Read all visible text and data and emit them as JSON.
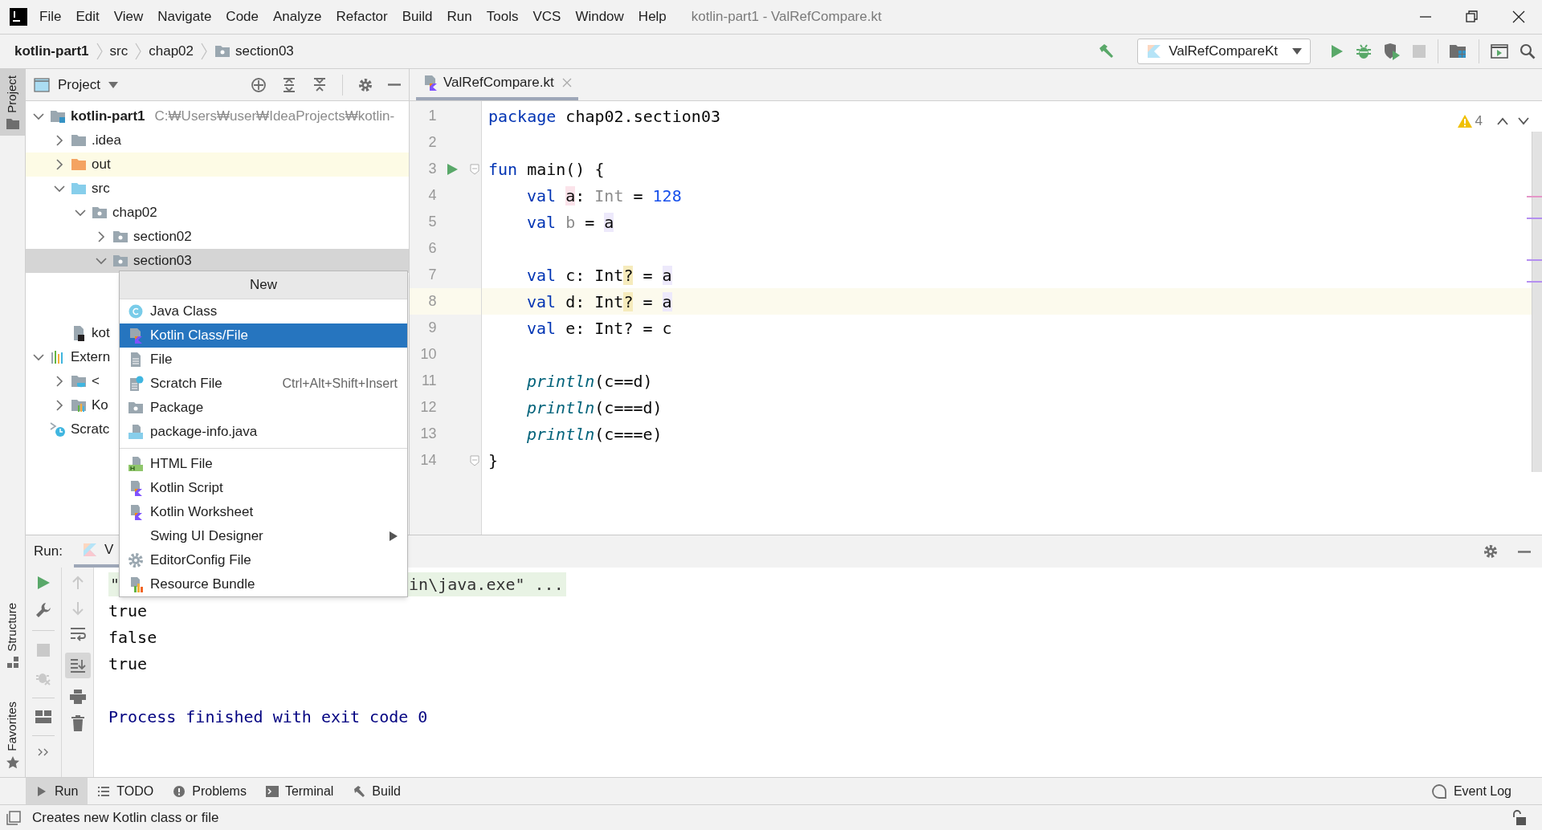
{
  "window": {
    "title": "kotlin-part1 - ValRefCompare.kt"
  },
  "menu_bar": [
    "File",
    "Edit",
    "View",
    "Navigate",
    "Code",
    "Analyze",
    "Refactor",
    "Build",
    "Run",
    "Tools",
    "VCS",
    "Window",
    "Help"
  ],
  "breadcrumbs": [
    {
      "label": "kotlin-part1",
      "kind": "project"
    },
    {
      "label": "src",
      "kind": "plain"
    },
    {
      "label": "chap02",
      "kind": "plain"
    },
    {
      "label": "section03",
      "kind": "package"
    }
  ],
  "run_configuration": "ValRefCompareKt",
  "side_tabs": [
    {
      "label": "Project",
      "selected": true,
      "kind": "top"
    },
    {
      "label": "Structure",
      "selected": false,
      "kind": "bottom"
    },
    {
      "label": "Favorites",
      "selected": false,
      "kind": "bottom"
    }
  ],
  "project_panel": {
    "title": "Project",
    "tree": [
      {
        "label": "kotlin-part1",
        "path": "C:₩Users₩user₩IdeaProjects₩kotlin-",
        "kind": "module",
        "expanded": true,
        "selected": false,
        "children": [
          {
            "label": ".idea",
            "kind": "folder",
            "expanded": false,
            "selected": false
          },
          {
            "label": "out",
            "kind": "excluded-folder",
            "expanded": false,
            "selected": false
          },
          {
            "label": "src",
            "kind": "source-folder",
            "expanded": true,
            "selected": false,
            "children": [
              {
                "label": "chap02",
                "kind": "package",
                "expanded": true,
                "selected": false,
                "children": [
                  {
                    "label": "section02",
                    "kind": "package",
                    "expanded": false,
                    "selected": false
                  },
                  {
                    "label": "section03",
                    "kind": "package",
                    "expanded": true,
                    "selected": true
                  }
                ]
              }
            ]
          },
          {
            "label": "kot",
            "kind": "module-file",
            "selected": false
          }
        ]
      },
      {
        "label": "Extern",
        "kind": "libraries",
        "expanded": true,
        "selected": false,
        "children": [
          {
            "label": "<",
            "kind": "sdk",
            "expanded": false,
            "selected": false
          },
          {
            "label": "Ko",
            "kind": "library",
            "expanded": false,
            "selected": false
          }
        ]
      },
      {
        "label": "Scratc",
        "kind": "scratches",
        "selected": false
      }
    ]
  },
  "editor": {
    "tabs": [
      {
        "label": "ValRefCompare.kt",
        "selected": true
      }
    ],
    "warnings": "4",
    "lines": [
      {
        "number": "1",
        "current": false,
        "runnable": false,
        "fold": false,
        "indented": false,
        "tokens": [
          {
            "text": "package",
            "kind": "keyword"
          },
          {
            "text": " chap02.section03",
            "kind": "plain"
          }
        ]
      },
      {
        "number": "2",
        "current": false,
        "runnable": false,
        "fold": false
      },
      {
        "number": "3",
        "current": false,
        "runnable": true,
        "fold": true,
        "indented": false,
        "tokens": [
          {
            "text": "fun",
            "kind": "keyword"
          },
          {
            "text": " main() {",
            "kind": "plain"
          }
        ]
      },
      {
        "number": "4",
        "current": false,
        "runnable": false,
        "fold": false,
        "indented": true,
        "tokens": [
          {
            "text": "val ",
            "kind": "keyword"
          },
          {
            "text": "a",
            "kind": "plain",
            "write_access": true
          },
          {
            "text": ": ",
            "kind": "plain"
          },
          {
            "text": "Int",
            "kind": "unused"
          },
          {
            "text": " = ",
            "kind": "plain"
          },
          {
            "text": "128",
            "kind": "number"
          }
        ]
      },
      {
        "number": "5",
        "current": false,
        "runnable": false,
        "fold": false,
        "indented": true,
        "tokens": [
          {
            "text": "val ",
            "kind": "keyword"
          },
          {
            "text": "b",
            "kind": "unused"
          },
          {
            "text": " = ",
            "kind": "plain"
          },
          {
            "text": "a",
            "kind": "plain",
            "read_access": true
          }
        ]
      },
      {
        "number": "6",
        "current": false,
        "runnable": false,
        "fold": false
      },
      {
        "number": "7",
        "current": false,
        "runnable": false,
        "fold": false,
        "indented": true,
        "tokens": [
          {
            "text": "val",
            "kind": "keyword"
          },
          {
            "text": " c: Int",
            "kind": "plain"
          },
          {
            "text": "?",
            "kind": "plain",
            "warning": true
          },
          {
            "text": " = ",
            "kind": "plain"
          },
          {
            "text": "a",
            "kind": "plain",
            "read_access": true
          }
        ]
      },
      {
        "number": "8",
        "current": true,
        "runnable": false,
        "fold": false,
        "indented": true,
        "tokens": [
          {
            "text": "val",
            "kind": "keyword"
          },
          {
            "text": " d: Int",
            "kind": "plain"
          },
          {
            "text": "?",
            "kind": "plain",
            "warning": true
          },
          {
            "text": " = ",
            "kind": "plain"
          },
          {
            "text": "a",
            "kind": "plain",
            "read_access": true
          }
        ]
      },
      {
        "number": "9",
        "current": false,
        "runnable": false,
        "fold": false,
        "indented": true,
        "tokens": [
          {
            "text": "val",
            "kind": "keyword"
          },
          {
            "text": " e: Int? = c",
            "kind": "plain"
          }
        ]
      },
      {
        "number": "10",
        "current": false,
        "runnable": false,
        "fold": false
      },
      {
        "number": "11",
        "current": false,
        "runnable": false,
        "fold": false,
        "indented": true,
        "tokens": [
          {
            "text": "println",
            "kind": "call"
          },
          {
            "text": "(c==d)",
            "kind": "plain"
          }
        ]
      },
      {
        "number": "12",
        "current": false,
        "runnable": false,
        "fold": false,
        "indented": true,
        "tokens": [
          {
            "text": "println",
            "kind": "call"
          },
          {
            "text": "(c===d)",
            "kind": "plain"
          }
        ]
      },
      {
        "number": "13",
        "current": false,
        "runnable": false,
        "fold": false,
        "indented": true,
        "tokens": [
          {
            "text": "println",
            "kind": "call"
          },
          {
            "text": "(c===e)",
            "kind": "plain"
          }
        ]
      },
      {
        "number": "14",
        "current": false,
        "runnable": false,
        "fold": true,
        "indented": false,
        "tokens": [
          {
            "text": "}",
            "kind": "plain"
          }
        ]
      }
    ]
  },
  "context_menu": {
    "title": "New",
    "items": [
      {
        "label": "Java Class",
        "kind": "java-class",
        "selected": false,
        "separator_before": false,
        "submenu": false
      },
      {
        "label": "Kotlin Class/File",
        "kind": "kotlin-file",
        "selected": true,
        "separator_before": false,
        "submenu": false
      },
      {
        "label": "File",
        "kind": "file",
        "selected": false,
        "separator_before": false,
        "submenu": false
      },
      {
        "label": "Scratch File",
        "kind": "scratch",
        "selected": false,
        "separator_before": false,
        "submenu": false,
        "shortcut": "Ctrl+Alt+Shift+Insert"
      },
      {
        "label": "Package",
        "kind": "package",
        "selected": false,
        "separator_before": false,
        "submenu": false
      },
      {
        "label": "package-info.java",
        "kind": "java-file",
        "selected": false,
        "separator_before": false,
        "submenu": false
      },
      {
        "label": "HTML File",
        "kind": "html",
        "selected": false,
        "separator_before": true,
        "submenu": false
      },
      {
        "label": "Kotlin Script",
        "kind": "kotlin-script",
        "selected": false,
        "separator_before": false,
        "submenu": false
      },
      {
        "label": "Kotlin Worksheet",
        "kind": "kotlin-script",
        "selected": false,
        "separator_before": false,
        "submenu": false
      },
      {
        "label": "Swing UI Designer",
        "kind": "none",
        "selected": false,
        "separator_before": false,
        "submenu": true
      },
      {
        "label": "EditorConfig File",
        "kind": "gear",
        "selected": false,
        "separator_before": false,
        "submenu": false
      },
      {
        "label": "Resource Bundle",
        "kind": "bundle",
        "selected": false,
        "separator_before": false,
        "submenu": false
      }
    ]
  },
  "run_panel": {
    "label": "Run:",
    "tab": "V",
    "scroll_to_end": true,
    "console": [
      {
        "kind": "command",
        "parts": [
          "\"",
          "in\\java.exe\" ..."
        ]
      },
      {
        "kind": "stdout",
        "text": "true"
      },
      {
        "kind": "stdout",
        "text": "false"
      },
      {
        "kind": "stdout",
        "text": "true"
      },
      {
        "kind": "system",
        "text": "Process finished with exit code 0",
        "gap_before": true
      }
    ]
  },
  "tool_windows": [
    {
      "label": "Run",
      "kind": "run",
      "selected": true
    },
    {
      "label": "TODO",
      "kind": "todo",
      "selected": false
    },
    {
      "label": "Problems",
      "kind": "problems",
      "selected": false
    },
    {
      "label": "Terminal",
      "kind": "terminal",
      "selected": false
    },
    {
      "label": "Build",
      "kind": "build",
      "selected": false
    }
  ],
  "event_log": "Event Log",
  "status_bar": {
    "message": "Creates new Kotlin class or file"
  }
}
